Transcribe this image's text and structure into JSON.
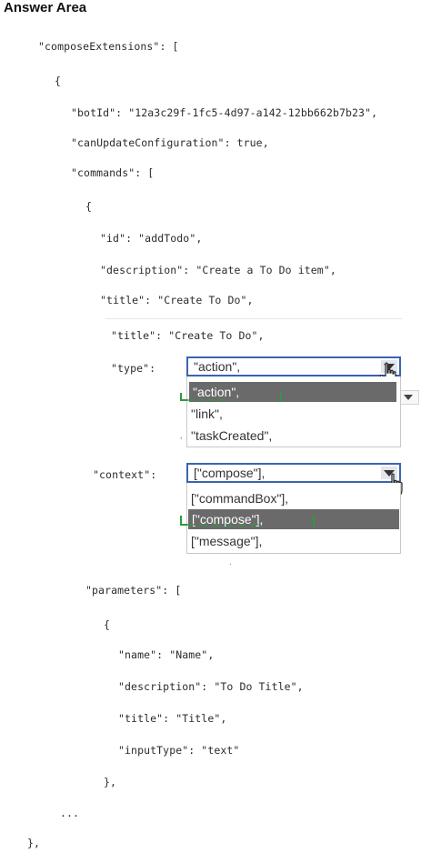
{
  "header": {
    "title": "Answer Area"
  },
  "code": {
    "l1": "\"composeExtensions\": [",
    "l2": "{",
    "l3": "\"botId\": \"12a3c29f-1fc5-4d97-a142-12bb662b7b23\",",
    "l4": "\"canUpdateConfiguration\": true,",
    "l5": "\"commands\": [",
    "l6": "{",
    "l7": "\"id\": \"addTodo\",",
    "l8": "\"description\": \"Create a To Do item\",",
    "l9": "\"title\": \"Create To Do\",",
    "l10": "\"title\": \"Create To Do\",",
    "type_key": "\"type\":",
    "context_key": "\"context\":",
    "l11": "\"parameters\": [",
    "l12": "{",
    "l13": "\"name\": \"Name\",",
    "l14": "\"description\": \"To Do Title\",",
    "l15": "\"title\": \"Title\",",
    "l16": "\"inputType\": \"text\"",
    "l17": "},",
    "l18": "...",
    "l19": "},"
  },
  "type_dropdown": {
    "selected": "\"action\",",
    "options": [
      "\"action\",",
      "\"link\",",
      "\"taskCreated\","
    ],
    "highlighted_index": 0
  },
  "context_dropdown": {
    "selected": "[\"compose\"],",
    "options": [
      "[\"commandBox\"],",
      "[\"compose\"],",
      "[\"message\"],"
    ],
    "highlighted_index": 1
  },
  "icons": {
    "hand_cursor": "hand-pointer-icon",
    "dropdown_arrow": "chevron-down-icon"
  },
  "colors": {
    "dropdown_border": "#3a64b0",
    "highlight_bg": "#6a6a6a",
    "green_marker": "#2e9a3c"
  }
}
